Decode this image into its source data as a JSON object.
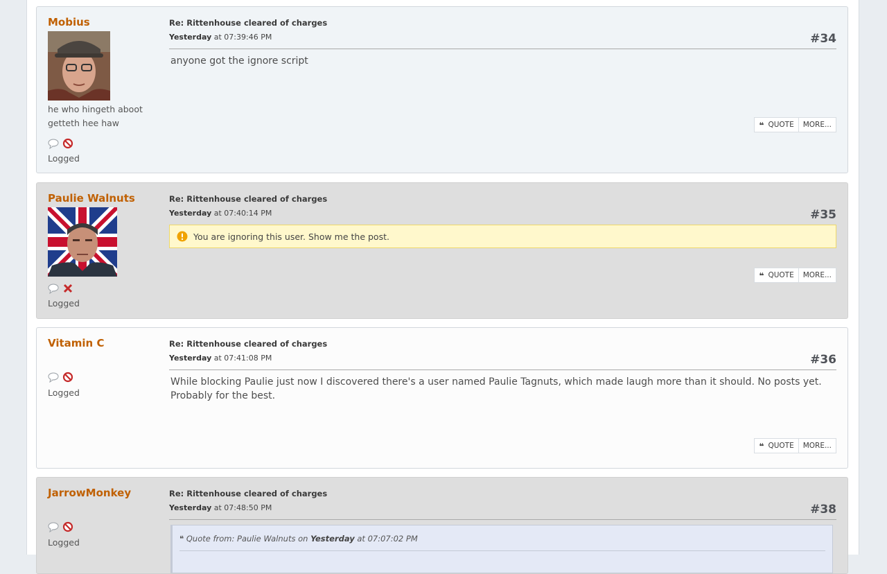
{
  "posts": [
    {
      "username": "Mobius",
      "subject": "Re: Rittenhouse cleared of charges",
      "date_day": "Yesterday",
      "date_time": "at 07:39:46 PM",
      "counter": "#34",
      "personal_text": "he who hingeth aboot getteth hee haw",
      "logged": "Logged",
      "body": "anyone got the ignore script",
      "quote_label": "QUOTE",
      "more_label": "MORE..."
    },
    {
      "username": "Paulie Walnuts",
      "subject": "Re: Rittenhouse cleared of charges",
      "date_day": "Yesterday",
      "date_time": "at 07:40:14 PM",
      "counter": "#35",
      "logged": "Logged",
      "ignore_notice": "You are ignoring this user. Show me the post.",
      "quote_label": "QUOTE",
      "more_label": "MORE..."
    },
    {
      "username": "Vitamin C",
      "subject": "Re: Rittenhouse cleared of charges",
      "date_day": "Yesterday",
      "date_time": "at 07:41:08 PM",
      "counter": "#36",
      "logged": "Logged",
      "body": "While blocking Paulie just now I discovered there's a user named Paulie Tagnuts, which made laugh more than it should. No posts yet. Probably for the best.",
      "quote_label": "QUOTE",
      "more_label": "MORE..."
    },
    {
      "username": "JarrowMonkey",
      "subject": "Re: Rittenhouse cleared of charges",
      "date_day": "Yesterday",
      "date_time": "at 07:48:50 PM",
      "counter": "#38",
      "logged": "Logged",
      "quote_prefix": "Quote from: Paulie Walnuts on",
      "quote_day": "Yesterday",
      "quote_time": "at 07:07:02 PM"
    }
  ],
  "colors": {
    "username": "#c06002",
    "background": "#e9edf1",
    "ignore_bg": "#fff8cc",
    "grey_post": "#dedede"
  }
}
